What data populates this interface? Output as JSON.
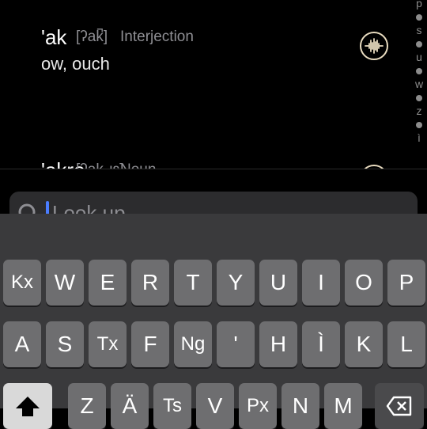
{
  "entries": [
    {
      "headword": "'ak",
      "phonetic": "[ʔak̚]",
      "pos": "Interjection",
      "gloss": "ow, ouch"
    },
    {
      "headword": "'akre",
      "phonetic": "[ʔak.ɹɛ]",
      "pos": "Noun"
    }
  ],
  "index": {
    "letters": [
      "p",
      "s",
      "u",
      "w",
      "z",
      "ì"
    ]
  },
  "search": {
    "placeholder": "Look up"
  },
  "keyboard": {
    "row1": [
      "Kx",
      "W",
      "E",
      "R",
      "T",
      "Y",
      "U",
      "I",
      "O",
      "P"
    ],
    "row2": [
      "A",
      "S",
      "Tx",
      "F",
      "Ng",
      "'",
      "H",
      "Ì",
      "K",
      "L"
    ],
    "row3": [
      "Z",
      "Ä",
      "Ts",
      "V",
      "Px",
      "N",
      "M"
    ]
  },
  "colors": {
    "audio_ring": "#e9dcc0",
    "caret": "#4a7dff",
    "key": "#6e6e70",
    "keyboard_bg": "#3a3a3c"
  }
}
